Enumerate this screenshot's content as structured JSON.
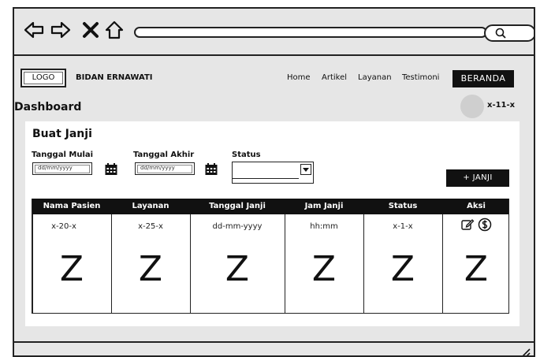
{
  "browser": {
    "nav_icons": [
      "back-arrow-icon",
      "forward-arrow-icon",
      "close-x-icon",
      "home-icon"
    ],
    "search_icon": "search-icon"
  },
  "header": {
    "logo": "LOGO",
    "brand": "BIDAN ERNAWATI",
    "nav": [
      "Home",
      "Artikel",
      "Layanan",
      "Testimoni"
    ],
    "cta": "BERANDA"
  },
  "dashboard": {
    "title": "Dashboard",
    "user": "x-11-x"
  },
  "form": {
    "title": "Buat Janji",
    "start_label": "Tanggal Mulai",
    "end_label": "Tanggal Akhir",
    "status_label": "Status",
    "start_placeholder": "dd/mm/yyyy",
    "end_placeholder": "dd/mm/yyyy",
    "add_button": "+ JANJI"
  },
  "table": {
    "columns": [
      "Nama Pasien",
      "Layanan",
      "Tanggal Janji",
      "Jam Janji",
      "Status",
      "Aksi"
    ],
    "row": [
      "x-20-x",
      "x-25-x",
      "dd-mm-yyyy",
      "hh:mm",
      "x-1-x"
    ],
    "placeholder_glyph": "Z",
    "action_icons": [
      "edit-icon",
      "dollar-icon"
    ]
  }
}
